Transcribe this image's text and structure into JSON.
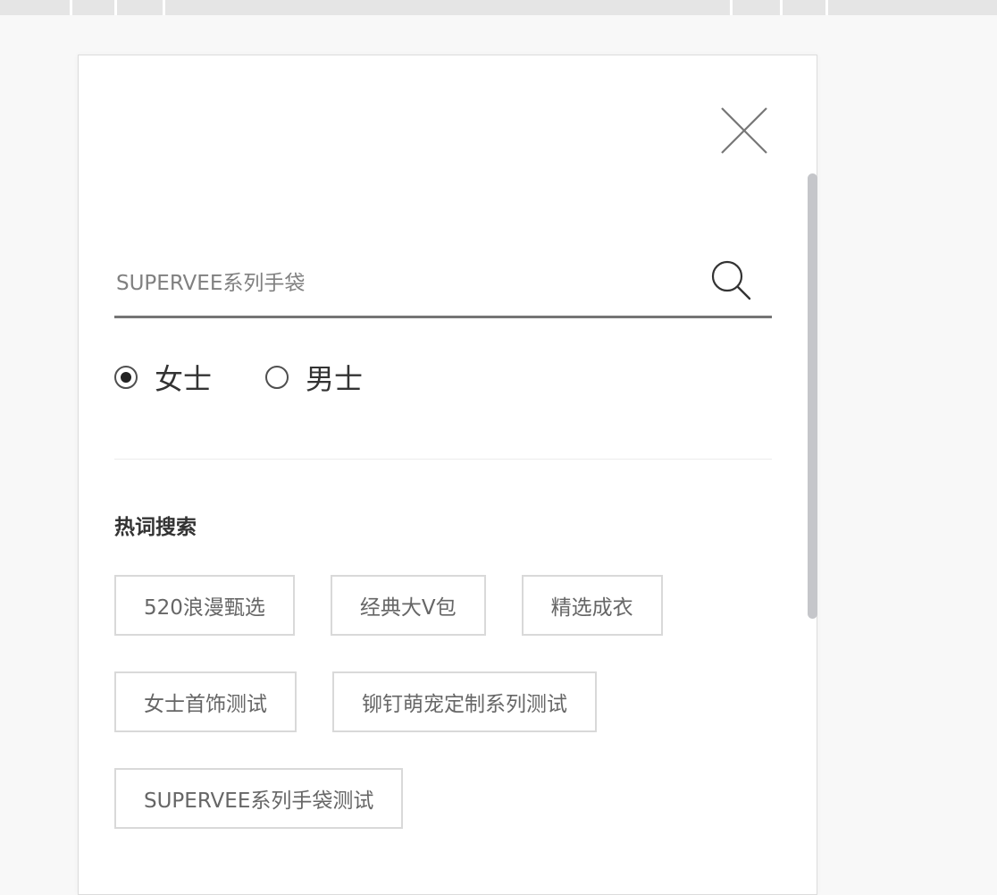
{
  "search": {
    "placeholder": "SUPERVEE系列手袋"
  },
  "gender": {
    "options": [
      {
        "label": "女士",
        "selected": true
      },
      {
        "label": "男士",
        "selected": false
      }
    ]
  },
  "hot_search": {
    "title": "热词搜索",
    "tags": [
      "520浪漫甄选",
      "经典大V包",
      "精选成衣",
      "女士首饰测试",
      "铆钉萌宠定制系列测试",
      "SUPERVEE系列手袋测试"
    ]
  },
  "icons": {
    "close": "close-icon",
    "search": "search-icon"
  },
  "colors": {
    "underline": "#757575",
    "tag_border": "#d9d9d9",
    "scrollbar": "#c5c6ca",
    "text_primary": "#333333",
    "text_muted": "#666666"
  }
}
